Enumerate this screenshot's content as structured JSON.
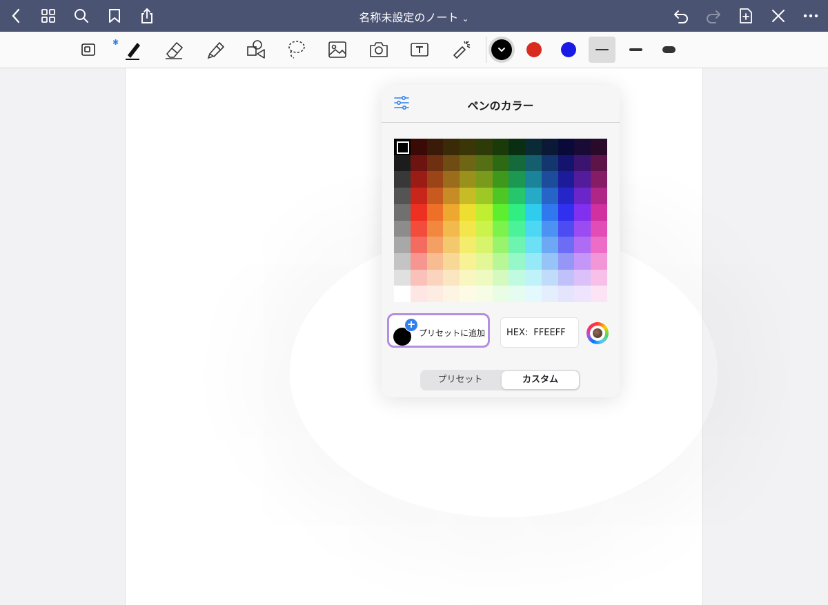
{
  "topbar": {
    "title": "名称未設定のノート",
    "title_chevron": "⌄",
    "left_icons": [
      "back-icon",
      "grid-icon",
      "search-icon",
      "bookmark-icon",
      "share-icon"
    ],
    "right_icons": [
      "undo-icon",
      "redo-icon",
      "add-page-icon",
      "close-icon",
      "more-icon"
    ]
  },
  "toolbar": {
    "tools": [
      "page-layout-icon",
      "pen-icon",
      "eraser-icon",
      "highlighter-icon",
      "shapes-icon",
      "lasso-icon",
      "image-icon",
      "camera-icon",
      "text-icon",
      "laser-pointer-icon"
    ],
    "colors": [
      {
        "name": "black",
        "hex": "#000000",
        "selected": true
      },
      {
        "name": "red",
        "hex": "#d92b1f",
        "selected": false
      },
      {
        "name": "blue",
        "hex": "#1a1ae6",
        "selected": false
      }
    ],
    "stroke_widths": [
      {
        "name": "thin",
        "selected": true
      },
      {
        "name": "medium",
        "selected": false
      },
      {
        "name": "thick",
        "selected": false
      }
    ]
  },
  "popover": {
    "title": "ペンのカラー",
    "preset_button_label": "プリセットに追加",
    "hex_label": "HEX:",
    "hex_value": "FFEEFF",
    "segments": [
      "プリセット",
      "カスタム"
    ],
    "active_segment": "カスタム"
  },
  "palette": [
    [
      "#000000",
      "#3a0a06",
      "#3a1a08",
      "#3a2a08",
      "#3a3608",
      "#2e3a08",
      "#1a3a0a",
      "#0a2e12",
      "#0a2a36",
      "#0a1a36",
      "#0a0a3a",
      "#1a0a36",
      "#2a0a2a"
    ],
    [
      "#1c1c1c",
      "#6e1410",
      "#6e3010",
      "#6e4c14",
      "#6e6614",
      "#566e14",
      "#2e6a14",
      "#146a3a",
      "#145e6e",
      "#14366e",
      "#14146e",
      "#3a146e",
      "#5e1448"
    ],
    [
      "#383838",
      "#9a1c14",
      "#9a4418",
      "#9a6c1c",
      "#9a901c",
      "#7a9a1c",
      "#3e981c",
      "#1c9852",
      "#1c849a",
      "#1c4c9a",
      "#1c1c9a",
      "#521c9a",
      "#861c66"
    ],
    [
      "#545454",
      "#c8261a",
      "#c85a20",
      "#c88c26",
      "#c8bc26",
      "#9ec826",
      "#4ec626",
      "#26c66c",
      "#26aac8",
      "#2664c8",
      "#2626c8",
      "#6a26c8",
      "#ae2686"
    ],
    [
      "#707070",
      "#ee3022",
      "#ee7028",
      "#eea830",
      "#eede30",
      "#c0ee30",
      "#5eee30",
      "#30ee82",
      "#30ccee",
      "#3078ee",
      "#3030ee",
      "#8030ee",
      "#d030a0"
    ],
    [
      "#8c8c8c",
      "#f24c3c",
      "#f28840",
      "#f2ba4c",
      "#f2e64c",
      "#ccf24c",
      "#7cf24c",
      "#4cf29a",
      "#4cd8f2",
      "#4c92f2",
      "#4c4cf2",
      "#9a4cf2",
      "#e24cb6"
    ],
    [
      "#a8a8a8",
      "#f46c60",
      "#f4a064",
      "#f4c86c",
      "#f4ec6c",
      "#d8f46c",
      "#98f46c",
      "#6cf4b0",
      "#6ce0f4",
      "#6ca8f4",
      "#6c6cf4",
      "#ae6cf4",
      "#ec6cc6"
    ],
    [
      "#c4c4c4",
      "#f79690",
      "#f7bc92",
      "#f7d896",
      "#f7f296",
      "#e4f796",
      "#b8f796",
      "#96f7c8",
      "#96eaf7",
      "#96c4f7",
      "#9696f7",
      "#c496f7",
      "#f296d8"
    ],
    [
      "#e0e0e0",
      "#fac0ba",
      "#fad4bc",
      "#fae6c0",
      "#faf6c0",
      "#eefac0",
      "#d4fac0",
      "#c0fae0",
      "#c0f2fa",
      "#c0dcfa",
      "#c0c0fa",
      "#dcc0fa",
      "#f8c0e8"
    ],
    [
      "#ffffff",
      "#fde6e4",
      "#fdece2",
      "#fdf4e4",
      "#fdfbe4",
      "#f6fde4",
      "#e8fde4",
      "#e4fdf0",
      "#e4f9fd",
      "#e4eefd",
      "#e4e4fd",
      "#eee4fd",
      "#fce4f4"
    ]
  ]
}
